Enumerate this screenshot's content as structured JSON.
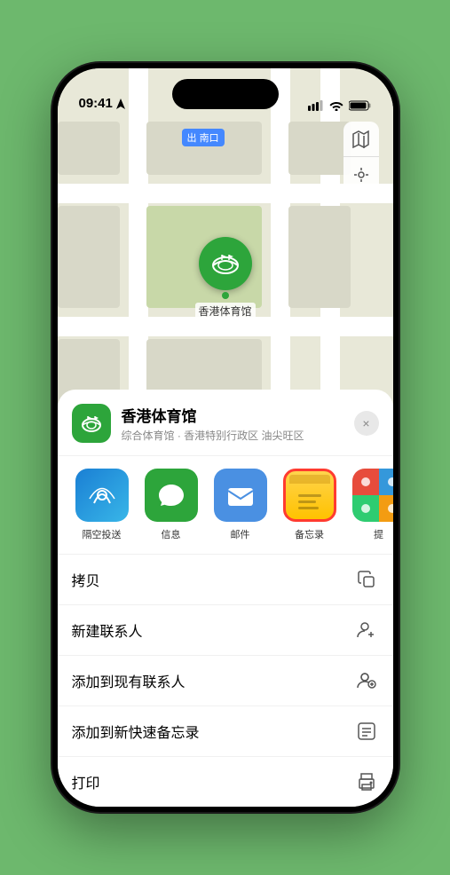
{
  "statusBar": {
    "time": "09:41",
    "timeArrow": "▶"
  },
  "map": {
    "label": "南口",
    "labelPrefix": "出",
    "stadiumEmoji": "🏟",
    "stadiumName": "香港体育馆",
    "mapIcon": "🗺",
    "locationIcon": "⊕"
  },
  "venueSheet": {
    "venueName": "香港体育馆",
    "venueSubtitle": "综合体育馆 · 香港特别行政区 油尖旺区",
    "closeLabel": "×",
    "shareItems": [
      {
        "id": "airdrop",
        "label": "隔空投送",
        "emoji": "📡"
      },
      {
        "id": "messages",
        "label": "信息",
        "emoji": "💬"
      },
      {
        "id": "mail",
        "label": "邮件",
        "emoji": "✉️"
      },
      {
        "id": "notes",
        "label": "备忘录",
        "emoji": ""
      },
      {
        "id": "more",
        "label": "提",
        "emoji": ""
      }
    ],
    "actions": [
      {
        "id": "copy",
        "label": "拷贝",
        "icon": "copy"
      },
      {
        "id": "new-contact",
        "label": "新建联系人",
        "icon": "person-add"
      },
      {
        "id": "add-existing",
        "label": "添加到现有联系人",
        "icon": "person-plus"
      },
      {
        "id": "add-notes",
        "label": "添加到新快速备忘录",
        "icon": "note"
      },
      {
        "id": "print",
        "label": "打印",
        "icon": "printer"
      }
    ]
  },
  "colors": {
    "green": "#2da53b",
    "blue": "#4a90e2",
    "red": "#ff3b30",
    "yellow": "#ffd44d"
  }
}
